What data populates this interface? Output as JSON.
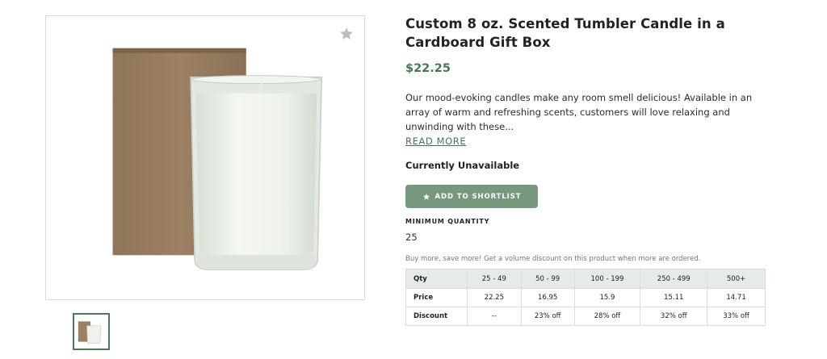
{
  "product": {
    "title": "Custom 8 oz. Scented Tumbler Candle in a Cardboard Gift Box",
    "price": "$22.25",
    "description": "Our mood-evoking candles make any room smell delicious! Available in an array of warm and refreshing scents, customers will love relaxing and unwinding with these...",
    "read_more_label": "READ MORE",
    "availability": "Currently Unavailable"
  },
  "actions": {
    "shortlist_label": "ADD TO SHORTLIST"
  },
  "minimum": {
    "label": "MINIMUM QUANTITY",
    "value": "25"
  },
  "pricing": {
    "note": "Buy more, save more! Get a volume discount on this product when more are ordered.",
    "headers": [
      "Qty",
      "25 - 49",
      "50 - 99",
      "100 - 199",
      "250 - 499",
      "500+"
    ],
    "price_row": [
      "Price",
      "22.25",
      "16.95",
      "15.9",
      "15.11",
      "14.71"
    ],
    "discount_row": [
      "Discount",
      "--",
      "23% off",
      "28% off",
      "32% off",
      "33% off"
    ]
  },
  "colors": {
    "accent_green": "#3f7a4d",
    "button_green": "#76987d",
    "table_header_bg": "#e6ebe7"
  },
  "icons": {
    "favorite": "star-icon",
    "shortlist": "star-icon"
  }
}
